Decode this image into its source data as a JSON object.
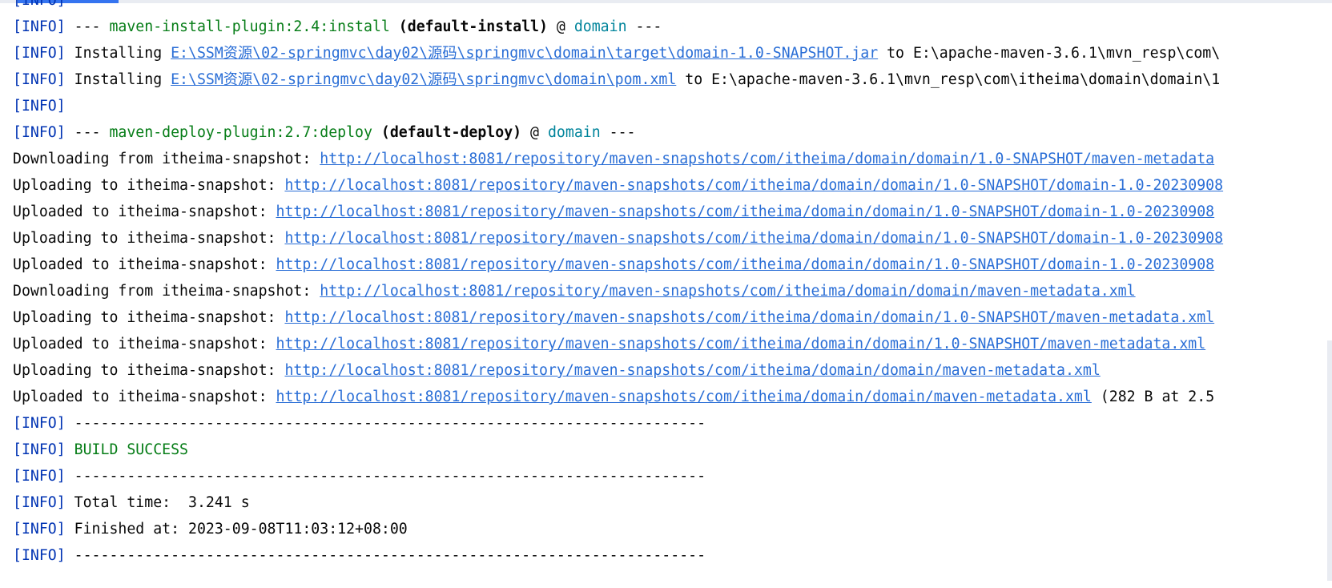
{
  "console": {
    "lines": [
      {
        "type": "plain",
        "level": "[INFO]",
        "text": ""
      },
      {
        "type": "plugin",
        "level": "[INFO]",
        "prefix": " --- ",
        "plugin": "maven-install-plugin:2.4:install",
        "goal": " (default-install)",
        "at": " @ ",
        "project": "domain",
        "suffix": " ---"
      },
      {
        "type": "install",
        "level": "[INFO]",
        "action": " Installing ",
        "path": "E:\\SSM资源\\02-springmvc\\day02\\源码\\springmvc\\domain\\target\\domain-1.0-SNAPSHOT.jar",
        "tail": " to E:\\apache-maven-3.6.1\\mvn_resp\\com\\"
      },
      {
        "type": "install",
        "level": "[INFO]",
        "action": " Installing ",
        "path": "E:\\SSM资源\\02-springmvc\\day02\\源码\\springmvc\\domain\\pom.xml",
        "tail": " to E:\\apache-maven-3.6.1\\mvn_resp\\com\\itheima\\domain\\domain\\1"
      },
      {
        "type": "plain",
        "level": "[INFO]",
        "text": ""
      },
      {
        "type": "plugin",
        "level": "[INFO]",
        "prefix": " --- ",
        "plugin": "maven-deploy-plugin:2.7:deploy",
        "goal": " (default-deploy)",
        "at": " @ ",
        "project": "domain",
        "suffix": " ---"
      },
      {
        "type": "transfer",
        "label": "Downloading from itheima-snapshot: ",
        "url": "http://localhost:8081/repository/maven-snapshots/com/itheima/domain/domain/1.0-SNAPSHOT/maven-metadata",
        "tail": ""
      },
      {
        "type": "transfer",
        "label": "Uploading to itheima-snapshot: ",
        "url": "http://localhost:8081/repository/maven-snapshots/com/itheima/domain/domain/1.0-SNAPSHOT/domain-1.0-20230908",
        "tail": ""
      },
      {
        "type": "transfer",
        "label": "Uploaded to itheima-snapshot: ",
        "url": "http://localhost:8081/repository/maven-snapshots/com/itheima/domain/domain/1.0-SNAPSHOT/domain-1.0-20230908",
        "tail": ""
      },
      {
        "type": "transfer",
        "label": "Uploading to itheima-snapshot: ",
        "url": "http://localhost:8081/repository/maven-snapshots/com/itheima/domain/domain/1.0-SNAPSHOT/domain-1.0-20230908",
        "tail": ""
      },
      {
        "type": "transfer",
        "label": "Uploaded to itheima-snapshot: ",
        "url": "http://localhost:8081/repository/maven-snapshots/com/itheima/domain/domain/1.0-SNAPSHOT/domain-1.0-20230908",
        "tail": ""
      },
      {
        "type": "transfer",
        "label": "Downloading from itheima-snapshot: ",
        "url": "http://localhost:8081/repository/maven-snapshots/com/itheima/domain/domain/maven-metadata.xml",
        "tail": ""
      },
      {
        "type": "transfer",
        "label": "Uploading to itheima-snapshot: ",
        "url": "http://localhost:8081/repository/maven-snapshots/com/itheima/domain/domain/1.0-SNAPSHOT/maven-metadata.xml",
        "tail": ""
      },
      {
        "type": "transfer",
        "label": "Uploaded to itheima-snapshot: ",
        "url": "http://localhost:8081/repository/maven-snapshots/com/itheima/domain/domain/1.0-SNAPSHOT/maven-metadata.xml",
        "tail": ""
      },
      {
        "type": "transfer",
        "label": "Uploading to itheima-snapshot: ",
        "url": "http://localhost:8081/repository/maven-snapshots/com/itheima/domain/domain/maven-metadata.xml",
        "tail": ""
      },
      {
        "type": "transfer",
        "label": "Uploaded to itheima-snapshot: ",
        "url": "http://localhost:8081/repository/maven-snapshots/com/itheima/domain/domain/maven-metadata.xml",
        "tail": " (282 B at 2.5"
      },
      {
        "type": "plain",
        "level": "[INFO]",
        "text": " ------------------------------------------------------------------------"
      },
      {
        "type": "success",
        "level": "[INFO]",
        "text": " BUILD SUCCESS"
      },
      {
        "type": "plain",
        "level": "[INFO]",
        "text": " ------------------------------------------------------------------------"
      },
      {
        "type": "plain",
        "level": "[INFO]",
        "text": " Total time:  3.241 s"
      },
      {
        "type": "plain",
        "level": "[INFO]",
        "text": " Finished at: 2023-09-08T11:03:12+08:00"
      },
      {
        "type": "plain",
        "level": "[INFO]",
        "text": " ------------------------------------------------------------------------"
      }
    ]
  }
}
